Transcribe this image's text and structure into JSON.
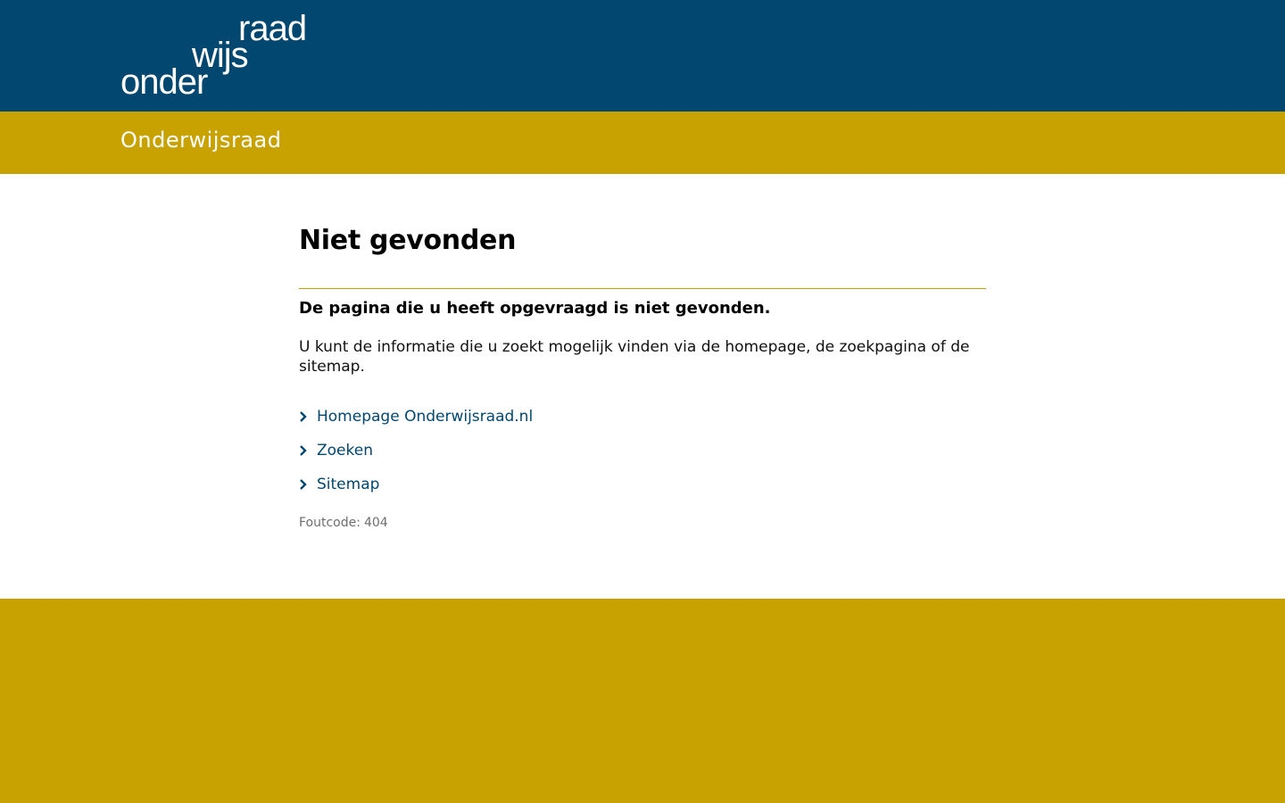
{
  "header": {
    "logo": {
      "line1": "onder",
      "line2": "wijs",
      "line3": "raad"
    }
  },
  "sitebar": {
    "site_name": "Onderwijsraad"
  },
  "main": {
    "title": "Niet gevonden",
    "lead": "De pagina die u heeft opgevraagd is niet gevonden.",
    "intro": "U kunt de informatie die u zoekt mogelijk vinden via de homepage, de zoekpagina of de sitemap.",
    "links": [
      {
        "label": "Homepage Onderwijsraad.nl",
        "icon": "chevron-right-icon"
      },
      {
        "label": "Zoeken",
        "icon": "chevron-right-icon"
      },
      {
        "label": "Sitemap",
        "icon": "chevron-right-icon"
      }
    ],
    "error_label": "Foutcode:",
    "error_code": "404"
  },
  "colors": {
    "header_blue": "#01476f",
    "accent_gold": "#c7a200",
    "link_blue": "#01476f"
  }
}
